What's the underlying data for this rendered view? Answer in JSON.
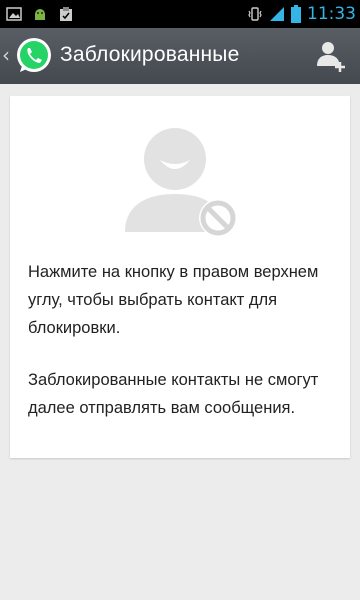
{
  "status_bar": {
    "time": "11:33",
    "icons": [
      "image-icon",
      "android-icon",
      "clipboard-icon",
      "vibrate-icon",
      "signal-icon",
      "battery-icon"
    ],
    "clock_color": "#34b5e5"
  },
  "action_bar": {
    "title": "Заблокированные",
    "back_icon": "chevron-left-icon",
    "app_icon": "whatsapp-logo",
    "action_icon": "add-contact-icon",
    "background": "#4c5258",
    "brand_color": "#25d366"
  },
  "content": {
    "illustration": "blocked-contact-icon",
    "instruction": "Нажмите на кнопку в правом верхнем углу, чтобы выбрать контакт для блокировки.",
    "explanation": "Заблокированные контакты не смогут далее отправлять вам сообщения."
  }
}
